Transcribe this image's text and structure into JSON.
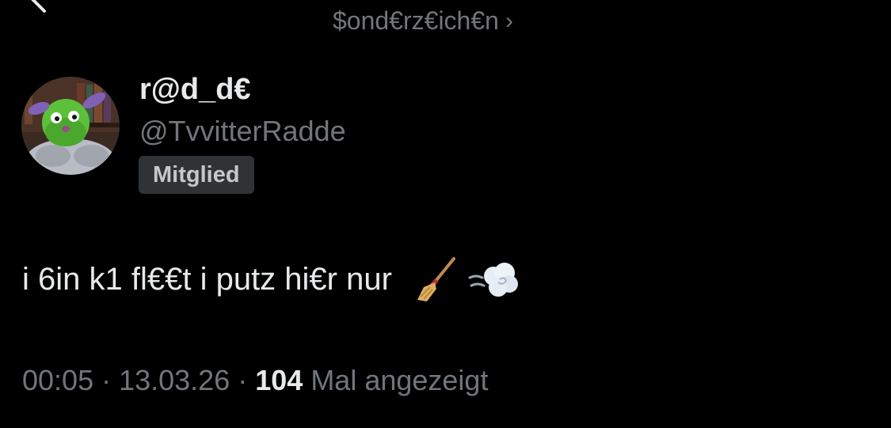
{
  "header": {
    "community_name": "$ond€rz€ich€n",
    "community_chevron": "›"
  },
  "author": {
    "display_name": "r@d_d€",
    "handle": "@TvvitterRadde",
    "badge": "Mitglied"
  },
  "post": {
    "text": "i 6in k1 fl€€t i putz hi€r nur",
    "emojis": [
      "broom-icon",
      "dashing-away-icon"
    ]
  },
  "meta": {
    "time": "00:05",
    "separator": " · ",
    "date": "13.03.26",
    "views_count": "104",
    "views_label": " Mal angezeigt"
  },
  "colors": {
    "background": "#000000",
    "primary_text": "#e7e9ea",
    "secondary_text": "#71767b",
    "badge_bg": "#2f3336"
  }
}
